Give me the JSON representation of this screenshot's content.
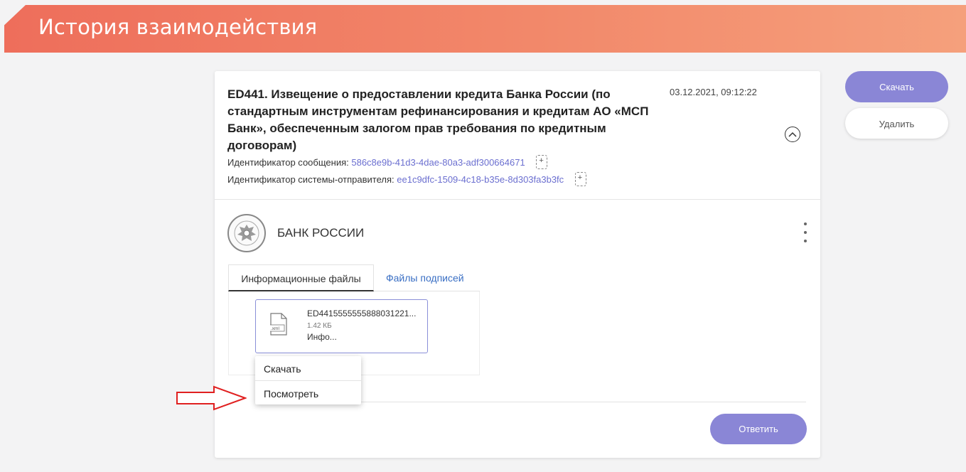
{
  "header": {
    "title": "История взаимодействия"
  },
  "message": {
    "title": "ED441. Извещение о предоставлении кредита Банка России (по стандартным инструментам рефинансирования и кредитам АО «МСП Банк», обеспеченным залогом прав требования по кредитным договорам)",
    "datetime": "03.12.2021, 09:12:22",
    "message_id_label": "Идентификатор сообщения:",
    "message_id": "586c8e9b-41d3-4dae-80a3-adf300664671",
    "sender_id_label": "Идентификатор системы-отправителя:",
    "sender_id": "ee1c9dfc-1509-4c18-b35e-8d303fa3b3fc"
  },
  "org": {
    "name": "БАНК РОССИИ"
  },
  "tabs": [
    {
      "label": "Информационные файлы",
      "active": true
    },
    {
      "label": "Файлы подписей",
      "active": false
    }
  ],
  "file": {
    "name": "ED4415555555888031221...",
    "size": "1.42 КБ",
    "desc": "Инфо...",
    "ext": ".xml"
  },
  "context_menu": [
    "Скачать",
    "Посмотреть"
  ],
  "actions": {
    "reply": "Ответить",
    "download": "Скачать",
    "delete": "Удалить"
  },
  "colors": {
    "accent": "#8a86d6",
    "link": "#6b6fd0",
    "header_start": "#ee6e5b",
    "header_end": "#f5a07c",
    "arrow": "#e02020"
  }
}
